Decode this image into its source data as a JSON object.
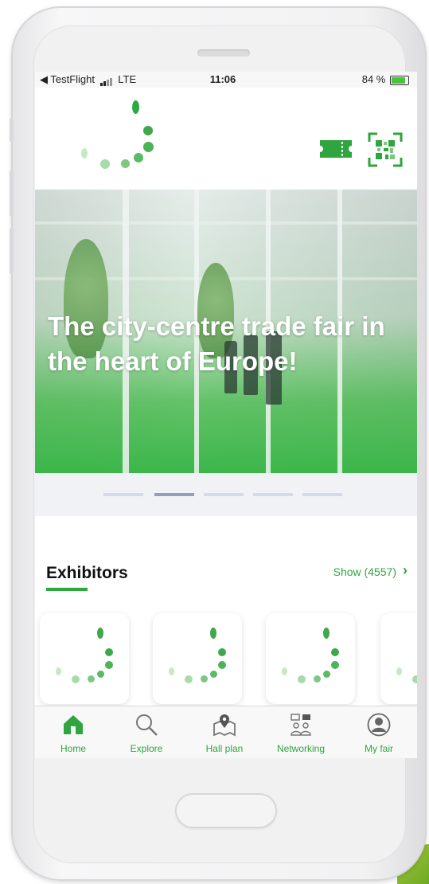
{
  "statusbar": {
    "carrier": "◀ TestFlight",
    "network": "LTE",
    "time": "11:06",
    "battery": "84 %"
  },
  "header": {
    "ticket_icon": "ticket-icon",
    "qr_icon": "qr-code-icon"
  },
  "hero": {
    "title": "The city-centre trade fair in the heart of Europe!",
    "slide_count": 5,
    "active_slide": 2
  },
  "exhibitors": {
    "title": "Exhibitors",
    "show_label": "Show (4557)",
    "chevron": "›"
  },
  "tabbar": {
    "items": [
      {
        "label": "Home",
        "icon": "home-icon"
      },
      {
        "label": "Explore",
        "icon": "search-icon"
      },
      {
        "label": "Hall plan",
        "icon": "map-pin-icon"
      },
      {
        "label": "Networking",
        "icon": "networking-icon"
      },
      {
        "label": "My fair",
        "icon": "user-icon"
      }
    ]
  },
  "colors": {
    "accent": "#2fa53f",
    "hero_green": "#3cb64a",
    "pager_active": "#94a0b8",
    "pager_inactive": "#d3daea"
  }
}
